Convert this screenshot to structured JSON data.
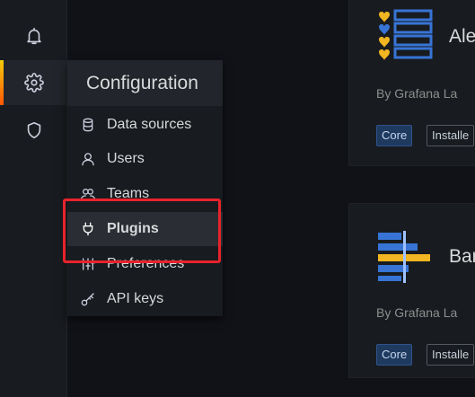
{
  "sidebar": {
    "icons": [
      {
        "name": "bell-icon"
      },
      {
        "name": "gear-icon",
        "active": true
      },
      {
        "name": "shield-icon"
      }
    ]
  },
  "flyout": {
    "title": "Configuration",
    "items": [
      {
        "label": "Data sources",
        "icon": "database-icon"
      },
      {
        "label": "Users",
        "icon": "user-icon"
      },
      {
        "label": "Teams",
        "icon": "users-icon"
      },
      {
        "label": "Plugins",
        "icon": "plug-icon",
        "active": true
      },
      {
        "label": "Preferences",
        "icon": "sliders-icon"
      },
      {
        "label": "API keys",
        "icon": "key-icon"
      }
    ]
  },
  "cards": [
    {
      "title": "Ale",
      "by": "By Grafana La",
      "core": "Core",
      "installed": "Installe"
    },
    {
      "title": "Bar",
      "by": "By Grafana La",
      "core": "Core",
      "installed": "Installe"
    }
  ],
  "colors": {
    "accent_gradient_start": "#f2cc0c",
    "accent_gradient_end": "#ff5705",
    "highlight": "#e8232c",
    "core_badge": "#1f3a5f"
  }
}
